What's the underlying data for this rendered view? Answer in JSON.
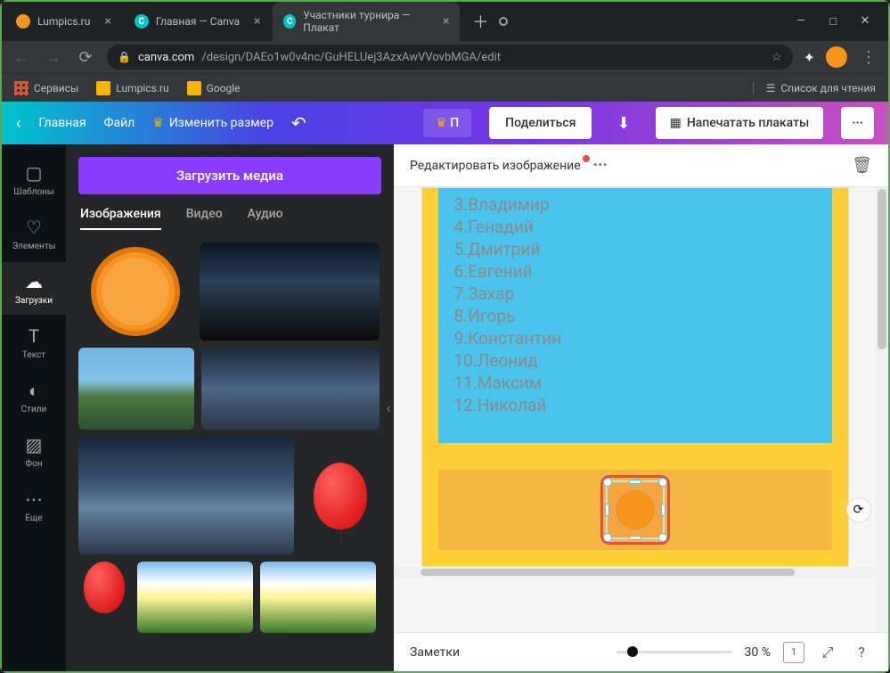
{
  "browser": {
    "tabs": [
      {
        "title": "Lumpics.ru",
        "icon": "orange",
        "active": false
      },
      {
        "title": "Главная — Canva",
        "icon": "canva",
        "active": false
      },
      {
        "title": "Участники турнира — Плакат",
        "icon": "canva",
        "active": true
      }
    ],
    "url_host": "canva.com",
    "url_path": "/design/DAEo1w0v4nc/GuHELUej3AzxAwVVovbMGA/edit",
    "bookmarks": {
      "services": "Сервисы",
      "lumpics": "Lumpics.ru",
      "google": "Google",
      "readlist": "Список для чтения"
    }
  },
  "canva": {
    "home": "Главная",
    "file": "Файл",
    "resize": "Изменить размер",
    "pro_cut": "П",
    "share": "Поделиться",
    "print": "Напечатать плакаты"
  },
  "leftnav": {
    "templates": "Шаблоны",
    "elements": "Элементы",
    "uploads": "Загрузки",
    "text": "Текст",
    "styles": "Стили",
    "background": "Фон",
    "more": "Еще"
  },
  "media": {
    "upload": "Загрузить медиа",
    "tabs": {
      "images": "Изображения",
      "video": "Видео",
      "audio": "Аудио"
    }
  },
  "toolbar": {
    "edit_image": "Редактировать изображение"
  },
  "doc": {
    "items": [
      {
        "n": "3.",
        "name": "Владимир"
      },
      {
        "n": "4.",
        "name": "Генадий"
      },
      {
        "n": "5.",
        "name": "Дмитрий"
      },
      {
        "n": "6.",
        "name": "Евгений"
      },
      {
        "n": "7.",
        "name": "Захар"
      },
      {
        "n": "8.",
        "name": "Игорь"
      },
      {
        "n": "9.",
        "name": "Константин"
      },
      {
        "n": "10.",
        "name": "Леонид"
      },
      {
        "n": "11.",
        "name": "Максим"
      },
      {
        "n": "12.",
        "name": "Николай"
      }
    ]
  },
  "bottom": {
    "notes": "Заметки",
    "zoom": "30 %",
    "page": "1"
  }
}
